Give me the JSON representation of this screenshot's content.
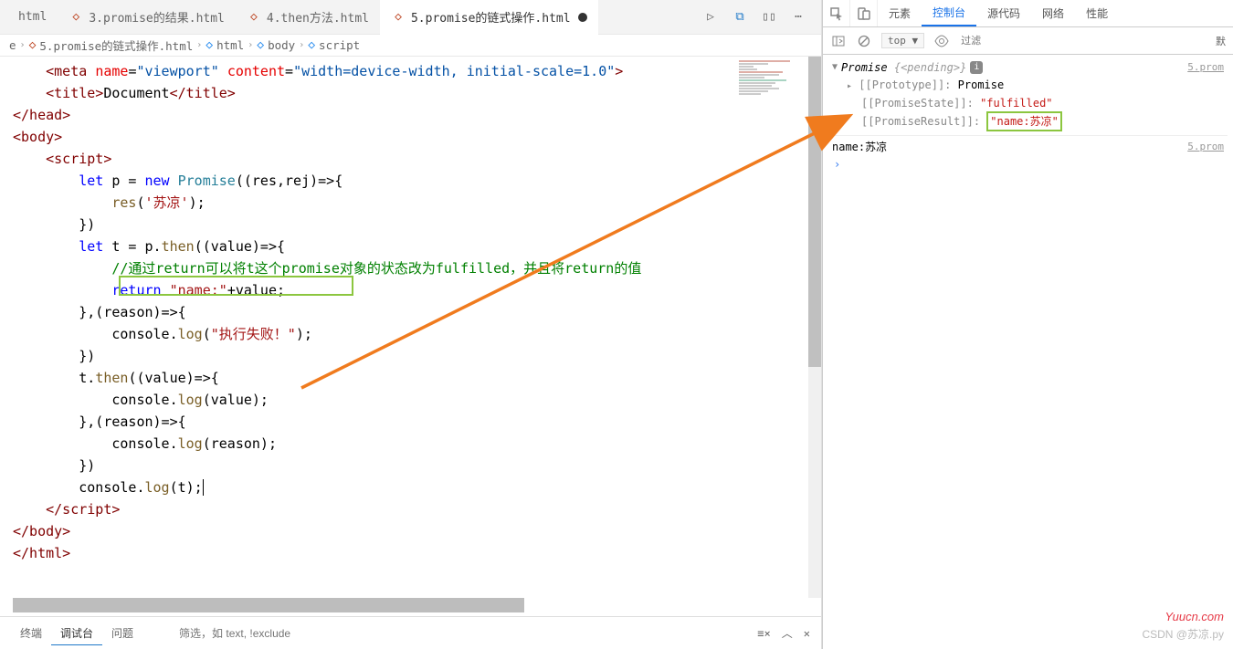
{
  "tabs": [
    {
      "label": "html"
    },
    {
      "label": "3.promise的结果.html"
    },
    {
      "label": "4.then方法.html"
    },
    {
      "label": "5.promise的链式操作.html",
      "active": true,
      "dirty": true
    }
  ],
  "breadcrumbs": {
    "items": [
      "e",
      "5.promise的链式操作.html",
      "html",
      "body",
      "script"
    ],
    "icons": [
      "",
      "◇",
      "◇",
      "◇",
      "◇"
    ]
  },
  "code": {
    "l1a": "<meta",
    "l1b": "name",
    "l1c": "\"viewport\"",
    "l1d": "content",
    "l1e": "\"width=device-width, initial-scale=1.0\"",
    "l2a": "<title>",
    "l2b": "Document",
    "l2c": "</title>",
    "l3": "</head>",
    "l4": "<body>",
    "l5": "<script>",
    "l6a": "let",
    "l6b": " p = ",
    "l6c": "new",
    "l6d": " Promise",
    "l6e": "((res,rej)=>{",
    "l7a": "res",
    "l7b": "(",
    "l7c": "'苏凉'",
    "l7d": ");",
    "l8": "})",
    "l9a": "let",
    "l9b": " t = p.",
    "l9c": "then",
    "l9d": "((value)=>{",
    "l10": "//通过return可以将t这个promise对象的状态改为fulfilled，并且将return的值",
    "l11a": "return",
    "l11b": " ",
    "l11c": "\"name:\"",
    "l11d": "+value;",
    "l12a": "},(reason)=>{",
    "l13a": "console.",
    "l13b": "log",
    "l13c": "(",
    "l13d": "\"执行失败！\"",
    "l13e": ");",
    "l14": "})",
    "l15a": "t.",
    "l15b": "then",
    "l15c": "((value)=>{",
    "l16a": "console.",
    "l16b": "log",
    "l16c": "(value);",
    "l17": "},(reason)=>{",
    "l18a": "console.",
    "l18b": "log",
    "l18c": "(reason);",
    "l19": "})",
    "l20a": "console.",
    "l20b": "log",
    "l20c": "(t);",
    "l21": "</script>",
    "l22": "</body>",
    "l23": "</html>"
  },
  "bottom": {
    "tabs": [
      "终端",
      "调试台",
      "问题"
    ],
    "filter_placeholder": "筛选，如 text, !exclude"
  },
  "devtools": {
    "tabs": [
      "元素",
      "控制台",
      "源代码",
      "网络",
      "性能"
    ],
    "activeTab": "控制台",
    "top_label": "top",
    "filter_placeholder": "过滤",
    "default_label": "默",
    "promise": {
      "head": "Promise",
      "pending": "{<pending>}",
      "proto_key": "[[Prototype]]:",
      "proto_val": " Promise",
      "state_key": "[[PromiseState]]:",
      "state_val": "\"fulfilled\"",
      "result_key": "[[PromiseResult]]:",
      "result_val": "\"name:苏凉\""
    },
    "log_line": "name:苏凉",
    "src": "5.prom",
    "prompt": "›"
  },
  "watermark1": "Yuucn.com",
  "watermark2": "CSDN @苏凉.py"
}
